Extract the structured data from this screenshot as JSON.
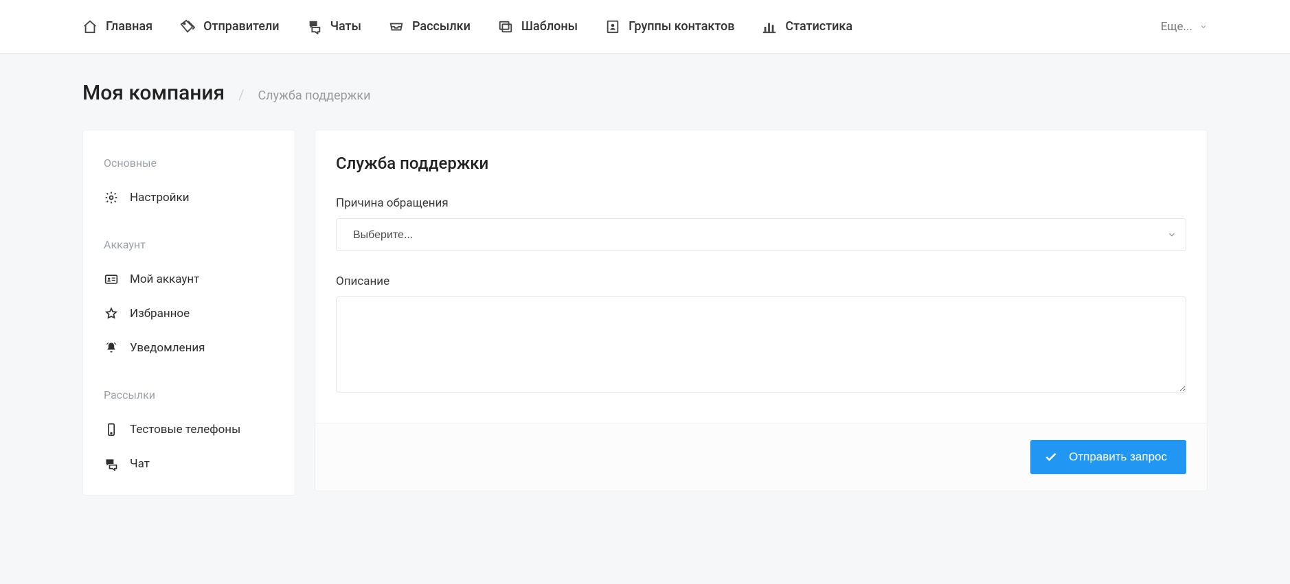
{
  "topnav": {
    "items": [
      {
        "label": "Главная"
      },
      {
        "label": "Отправители"
      },
      {
        "label": "Чаты"
      },
      {
        "label": "Рассылки"
      },
      {
        "label": "Шаблоны"
      },
      {
        "label": "Группы контактов"
      },
      {
        "label": "Статистика"
      }
    ],
    "more_label": "Еще..."
  },
  "breadcrumb": {
    "title": "Моя компания",
    "crumb": "Служба поддержки"
  },
  "sidebar": {
    "sections": [
      {
        "label": "Основные",
        "items": [
          {
            "label": "Настройки"
          }
        ]
      },
      {
        "label": "Аккаунт",
        "items": [
          {
            "label": "Мой аккаунт"
          },
          {
            "label": "Избранное"
          },
          {
            "label": "Уведомления"
          }
        ]
      },
      {
        "label": "Рассылки",
        "items": [
          {
            "label": "Тестовые телефоны"
          },
          {
            "label": "Чат"
          }
        ]
      }
    ]
  },
  "form": {
    "title": "Служба поддержки",
    "reason_label": "Причина обращения",
    "reason_placeholder": "Выберите...",
    "description_label": "Описание",
    "submit_label": "Отправить запрос"
  }
}
